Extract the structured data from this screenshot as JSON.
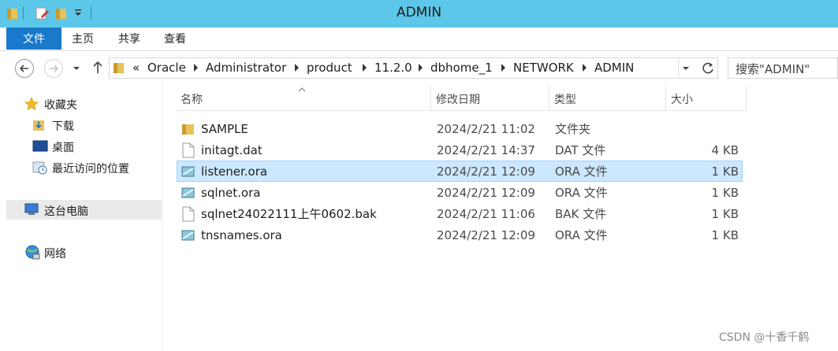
{
  "window": {
    "title": "ADMIN"
  },
  "ribbon": {
    "file_tab": "文件",
    "tabs": [
      "主页",
      "共享",
      "查看"
    ]
  },
  "address": {
    "overflow": "«",
    "crumbs": [
      "Oracle",
      "Administrator",
      "product",
      "11.2.0",
      "dbhome_1",
      "NETWORK",
      "ADMIN"
    ],
    "search_placeholder": "搜索\"ADMIN\""
  },
  "nav": {
    "favorites": "收藏夹",
    "fav_items": [
      "下载",
      "桌面",
      "最近访问的位置"
    ],
    "this_pc": "这台电脑",
    "network": "网络"
  },
  "columns": {
    "name": "名称",
    "modified": "修改日期",
    "type": "类型",
    "size": "大小"
  },
  "files": [
    {
      "name": "SAMPLE",
      "modified": "2024/2/21 11:02",
      "type": "文件夹",
      "size": "",
      "icon": "folder-icon"
    },
    {
      "name": "initagt.dat",
      "modified": "2024/2/21 14:37",
      "type": "DAT 文件",
      "size": "4 KB",
      "icon": "document-icon"
    },
    {
      "name": "listener.ora",
      "modified": "2024/2/21 12:09",
      "type": "ORA 文件",
      "size": "1 KB",
      "icon": "ora-file-icon",
      "selected": true
    },
    {
      "name": "sqlnet.ora",
      "modified": "2024/2/21 12:09",
      "type": "ORA 文件",
      "size": "1 KB",
      "icon": "ora-file-icon"
    },
    {
      "name": "sqlnet24022111上午0602.bak",
      "modified": "2024/2/21 11:06",
      "type": "BAK 文件",
      "size": "1 KB",
      "icon": "document-icon"
    },
    {
      "name": "tnsnames.ora",
      "modified": "2024/2/21 12:09",
      "type": "ORA 文件",
      "size": "1 KB",
      "icon": "ora-file-icon"
    }
  ],
  "watermark": "CSDN @十香千鹤",
  "colors": {
    "titlebar": "#5cc7e9",
    "file_tab": "#1979ca",
    "selection": "#cce8ff",
    "selection_border": "#99d1ff"
  }
}
